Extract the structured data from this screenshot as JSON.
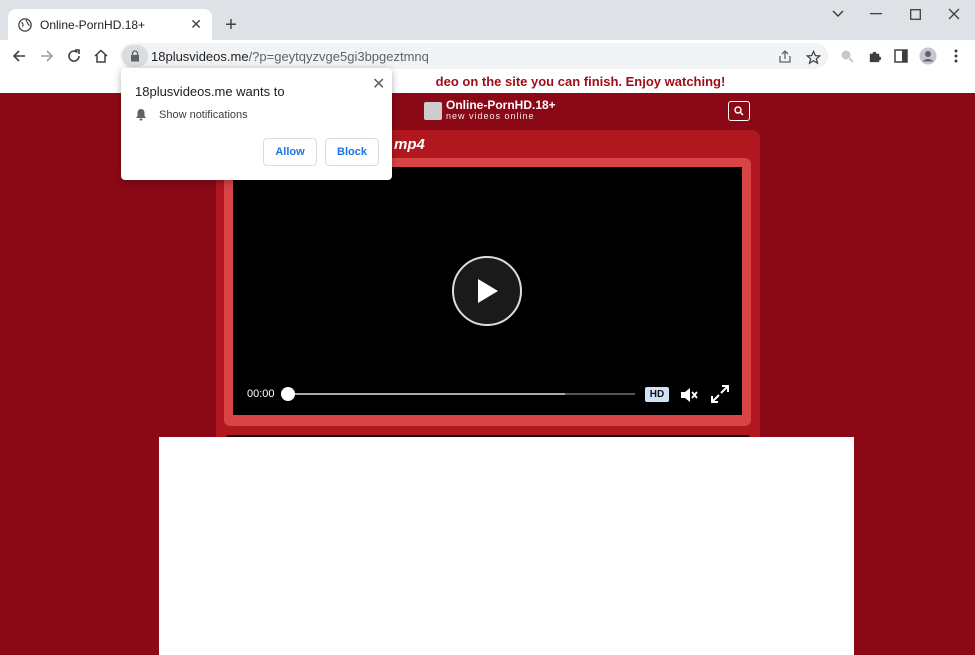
{
  "browser": {
    "tab_title": "Online-PornHD.18+",
    "url_domain": "18plusvideos.me",
    "url_path": "/?p=geytqyzvge5gi3bpgeztmnq"
  },
  "page": {
    "banner_text": "deo on the site you can finish. Enjoy watching!",
    "logo_title": "Online-PornHD.18+",
    "logo_subtitle": "new videos online",
    "panel_title": "mp4",
    "player": {
      "time": "00:00",
      "hd_label": "HD",
      "progress": 0.0,
      "buffered": 0.8
    }
  },
  "notification": {
    "title": "18plusvideos.me wants to",
    "permission": "Show notifications",
    "allow_label": "Allow",
    "block_label": "Block"
  },
  "colors": {
    "page_bg": "#8b0916",
    "panel": "#b0171f",
    "banner_text": "#9d0c19",
    "button_text": "#1a73e8"
  }
}
